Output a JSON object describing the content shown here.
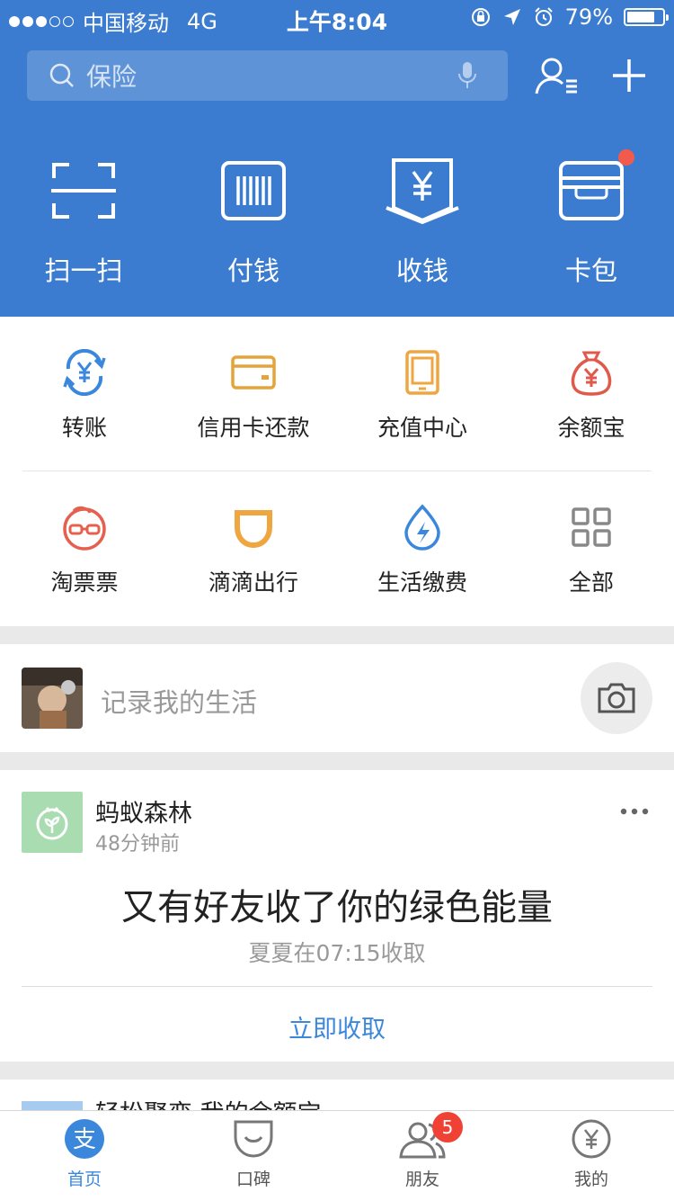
{
  "status_bar": {
    "carrier": "中国移动",
    "network": "4G",
    "time": "上午8:04",
    "battery_percent": "79%",
    "battery_level": 0.79
  },
  "header": {
    "search_placeholder": "保险",
    "icons": [
      "search-icon",
      "mic-icon",
      "contacts-icon",
      "plus-icon"
    ]
  },
  "main_functions": [
    {
      "label": "扫一扫",
      "icon": "scan-icon"
    },
    {
      "label": "付钱",
      "icon": "barcode-icon"
    },
    {
      "label": "收钱",
      "icon": "receive-money-icon"
    },
    {
      "label": "卡包",
      "icon": "card-wallet-icon"
    }
  ],
  "services": [
    {
      "label": "转账",
      "icon": "transfer-icon",
      "color": "#3b87dc"
    },
    {
      "label": "信用卡还款",
      "icon": "credit-card-icon",
      "color": "#e5a43a"
    },
    {
      "label": "充值中心",
      "icon": "phone-recharge-icon",
      "color": "#f0a640"
    },
    {
      "label": "余额宝",
      "icon": "money-bag-icon",
      "color": "#e05a4c"
    },
    {
      "label": "淘票票",
      "icon": "glasses-face-icon",
      "color": "#e5604e"
    },
    {
      "label": "滴滴出行",
      "icon": "didi-icon",
      "color": "#f0a640"
    },
    {
      "label": "生活缴费",
      "icon": "water-drop-icon",
      "color": "#3b87dc"
    },
    {
      "label": "全部",
      "icon": "grid-icon",
      "color": "#888888"
    }
  ],
  "post_prompt": {
    "placeholder": "记录我的生活"
  },
  "feed_card": {
    "source_name": "蚂蚁森林",
    "time_ago": "48分钟前",
    "headline": "又有好友收了你的绿色能量",
    "subtext": "夏夏在07:15收取",
    "action_label": "立即收取"
  },
  "next_card_title": "轻松聚变 我的余额宝",
  "tab_bar": [
    {
      "label": "首页",
      "icon": "alipay-home-icon",
      "active": true
    },
    {
      "label": "口碑",
      "icon": "koubei-icon",
      "active": false
    },
    {
      "label": "朋友",
      "icon": "friends-icon",
      "active": false,
      "badge": "5"
    },
    {
      "label": "我的",
      "icon": "profile-icon",
      "active": false
    }
  ],
  "colors": {
    "brand_blue": "#3b7cd0",
    "link_blue": "#3b87dc",
    "badge_red": "#f04234"
  }
}
